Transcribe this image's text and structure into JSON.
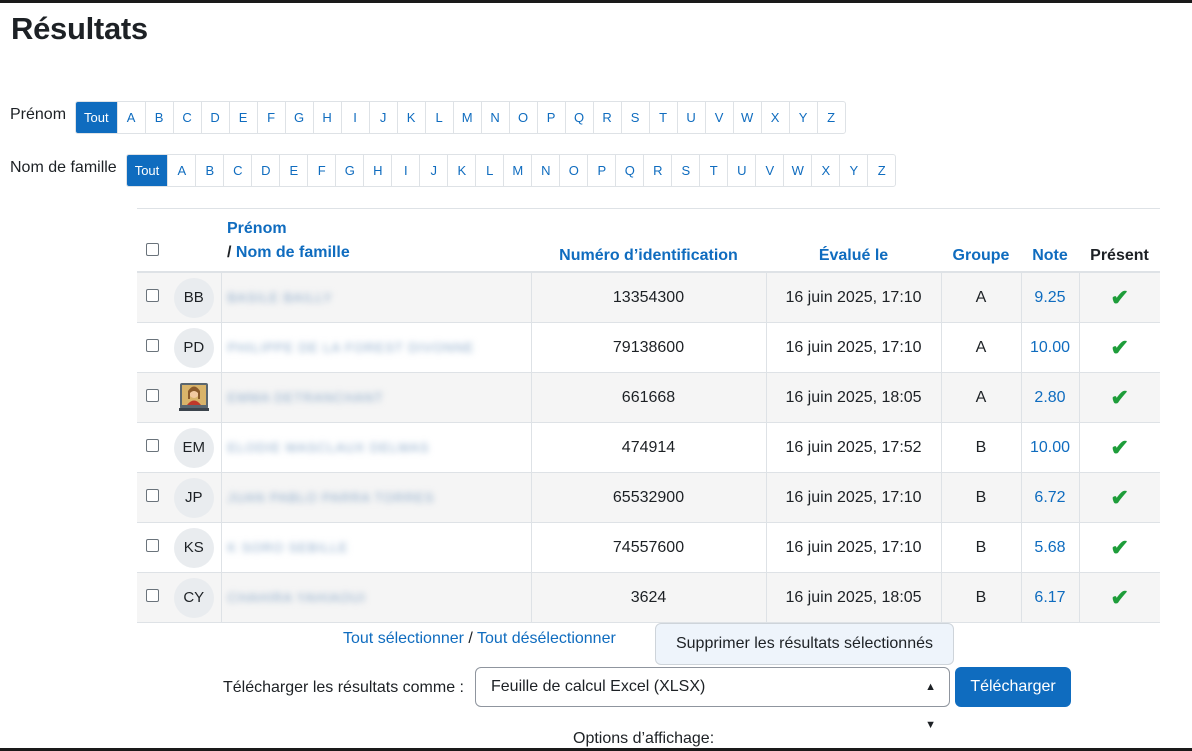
{
  "page": {
    "title": "Résultats"
  },
  "filters": {
    "firstname": {
      "label": "Prénom",
      "all": "Tout",
      "letters": [
        "A",
        "B",
        "C",
        "D",
        "E",
        "F",
        "G",
        "H",
        "I",
        "J",
        "K",
        "L",
        "M",
        "N",
        "O",
        "P",
        "Q",
        "R",
        "S",
        "T",
        "U",
        "V",
        "W",
        "X",
        "Y",
        "Z"
      ]
    },
    "lastname": {
      "label": "Nom de famille",
      "all": "Tout",
      "letters": [
        "A",
        "B",
        "C",
        "D",
        "E",
        "F",
        "G",
        "H",
        "I",
        "J",
        "K",
        "L",
        "M",
        "N",
        "O",
        "P",
        "Q",
        "R",
        "S",
        "T",
        "U",
        "V",
        "W",
        "X",
        "Y",
        "Z"
      ]
    }
  },
  "table": {
    "headers": {
      "firstname": "Prénom",
      "separator": "/",
      "lastname": "Nom de famille",
      "idnumber": "Numéro d’identification",
      "evaluated": "Évalué le",
      "group": "Groupe",
      "grade": "Note",
      "present": "Présent"
    },
    "rows": [
      {
        "initials": "BB",
        "name": "BASILE BAILLY",
        "idnumber": "13354300",
        "evaluated": "16 juin 2025, 17:10",
        "group": "A",
        "grade": "9.25",
        "present": "✔"
      },
      {
        "initials": "PD",
        "name": "PHILIPPE DE LA FOREST DIVONNE",
        "idnumber": "79138600",
        "evaluated": "16 juin 2025, 17:10",
        "group": "A",
        "grade": "10.00",
        "present": "✔"
      },
      {
        "initials": "",
        "name": "EMMA DETRANCHANT",
        "idnumber": "661668",
        "evaluated": "16 juin 2025, 18:05",
        "group": "A",
        "grade": "2.80",
        "present": "✔"
      },
      {
        "initials": "EM",
        "name": "ELODIE MASCLAUX DELMAS",
        "idnumber": "474914",
        "evaluated": "16 juin 2025, 17:52",
        "group": "B",
        "grade": "10.00",
        "present": "✔"
      },
      {
        "initials": "JP",
        "name": "JUAN PABLO PARRA TORRES",
        "idnumber": "65532900",
        "evaluated": "16 juin 2025, 17:10",
        "group": "B",
        "grade": "6.72",
        "present": "✔"
      },
      {
        "initials": "KS",
        "name": "K SORO SEBILLE",
        "idnumber": "74557600",
        "evaluated": "16 juin 2025, 17:10",
        "group": "B",
        "grade": "5.68",
        "present": "✔"
      },
      {
        "initials": "CY",
        "name": "CHAHIRA YAHIAOUI",
        "idnumber": "3624",
        "evaluated": "16 juin 2025, 18:05",
        "group": "B",
        "grade": "6.17",
        "present": "✔"
      }
    ]
  },
  "actions": {
    "select_all": "Tout sélectionner",
    "separator": "/",
    "deselect_all": "Tout désélectionner",
    "delete_selected": "Supprimer les résultats sélectionnés",
    "download_label": "Télécharger les résultats comme :",
    "download_format": "Feuille de calcul Excel (XLSX)",
    "download_button": "Télécharger",
    "display_options": "Options d’affichage:"
  },
  "colors": {
    "link": "#0f6cbf",
    "check": "#1e9d3a",
    "active_pager": "#0f6cbf"
  }
}
